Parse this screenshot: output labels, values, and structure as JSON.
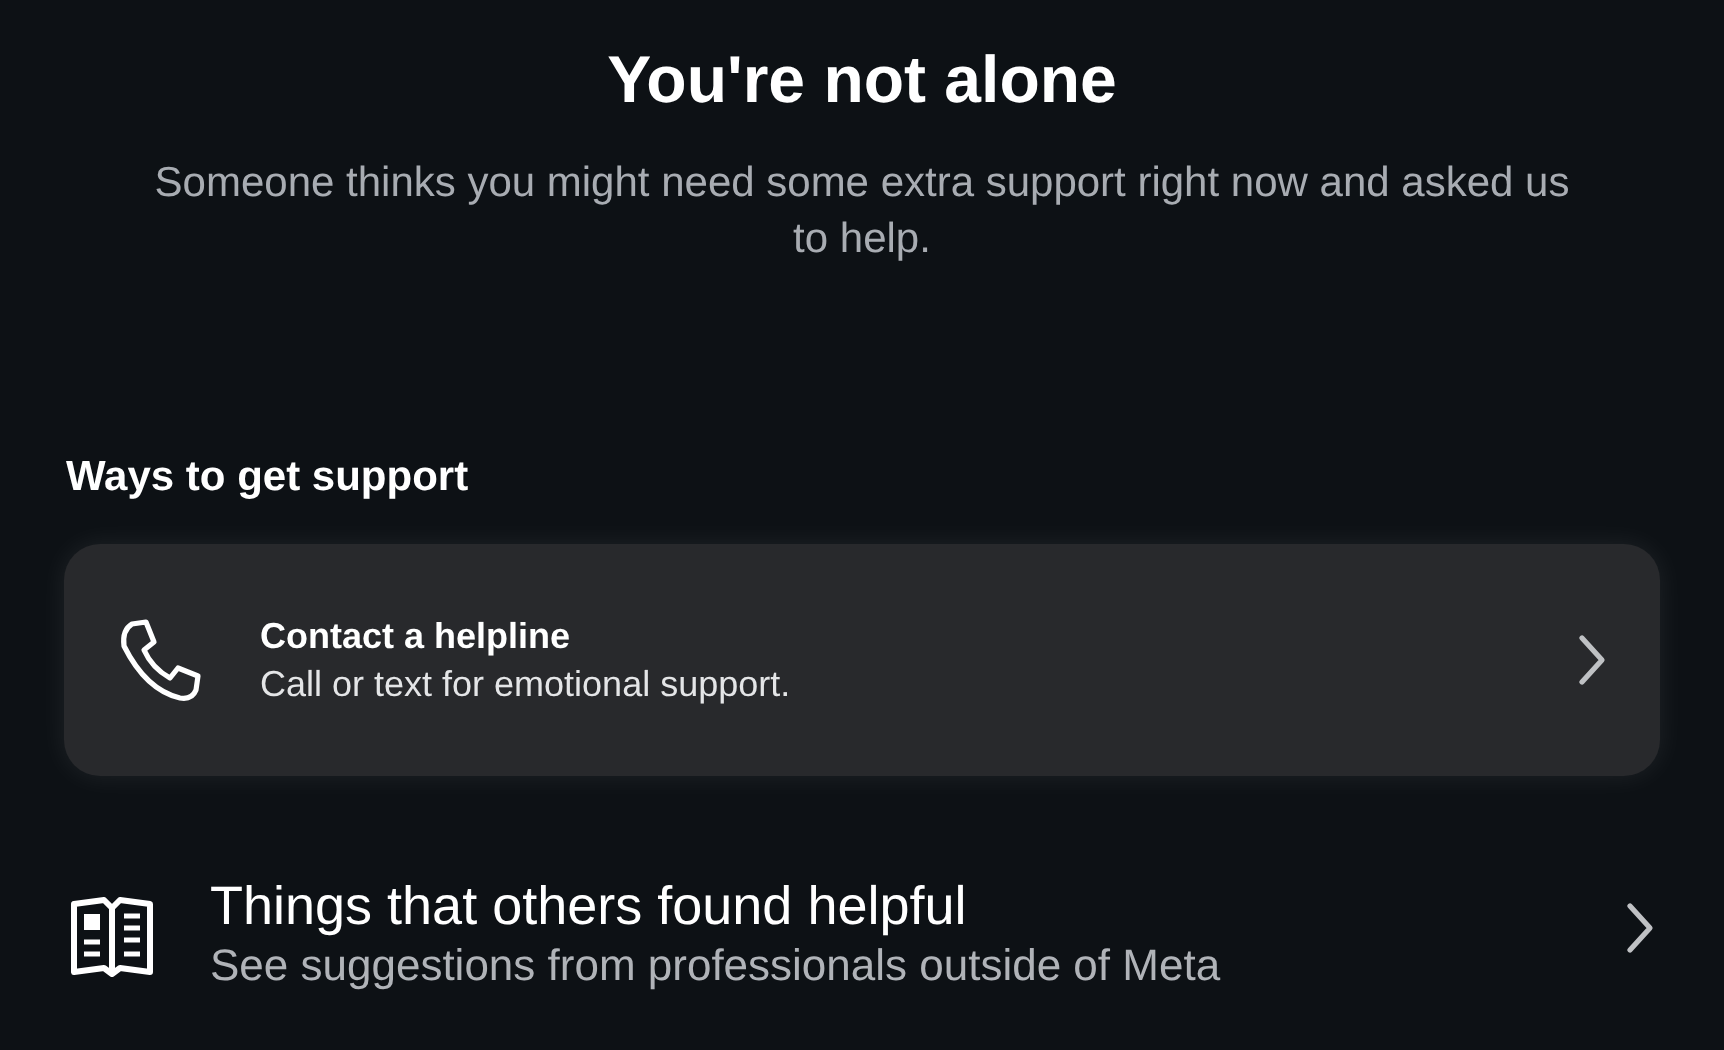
{
  "title": "You're not alone",
  "intro": "Someone thinks you might need some extra support right now and asked us to help.",
  "section": "Ways to get support",
  "options": [
    {
      "kind": "phone",
      "title": "Contact a helpline",
      "subtitle": "Call or text for emotional support.",
      "selected": true
    },
    {
      "kind": "book",
      "title": "Things that others found helpful",
      "subtitle": "See suggestions from professionals outside of Meta",
      "selected": false
    }
  ]
}
